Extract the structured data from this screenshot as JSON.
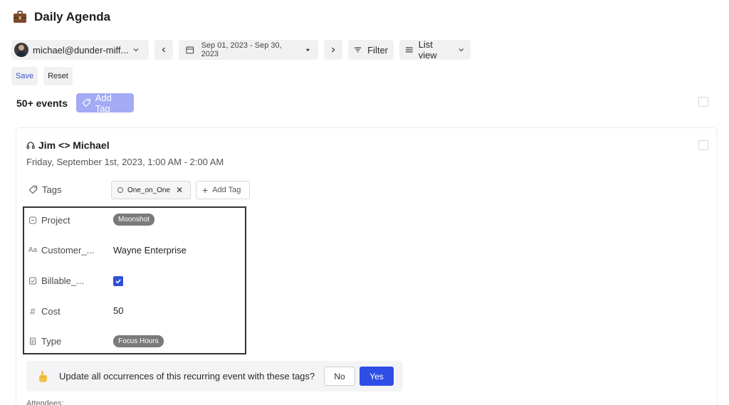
{
  "header": {
    "title": "Daily Agenda",
    "icon": "briefcase-icon"
  },
  "toolbar": {
    "user_email": "michael@dunder-miff...",
    "date_range": "Sep 01, 2023 - Sep 30, 2023",
    "filter_label": "Filter",
    "view_label": "List view"
  },
  "actions": {
    "save_label": "Save",
    "reset_label": "Reset"
  },
  "events": {
    "count_label": "50+ events",
    "add_tag_label": "Add Tag"
  },
  "event": {
    "title": "Jim <> Michael",
    "datetime": "Friday, September 1st, 2023, 1:00 AM - 2:00 AM",
    "tags_label": "Tags",
    "tag_name": "One_on_One",
    "add_tag_label": "Add Tag",
    "properties": {
      "project": {
        "label": "Project",
        "value": "Moonshot"
      },
      "customer": {
        "label": "Customer_...",
        "value": "Wayne Enterprise"
      },
      "billable": {
        "label": "Billable_...",
        "checked": true
      },
      "cost": {
        "label": "Cost",
        "value": "50"
      },
      "type": {
        "label": "Type",
        "value": "Focus Hours"
      }
    }
  },
  "prompt": {
    "text": "Update all occurrences of this recurring event with these tags?",
    "no_label": "No",
    "yes_label": "Yes"
  },
  "attendees_label": "Attendees:",
  "colors": {
    "accent": "#2e4ee6",
    "add_tag_bg": "#a3abf4",
    "badge": "#7a7a7a"
  }
}
